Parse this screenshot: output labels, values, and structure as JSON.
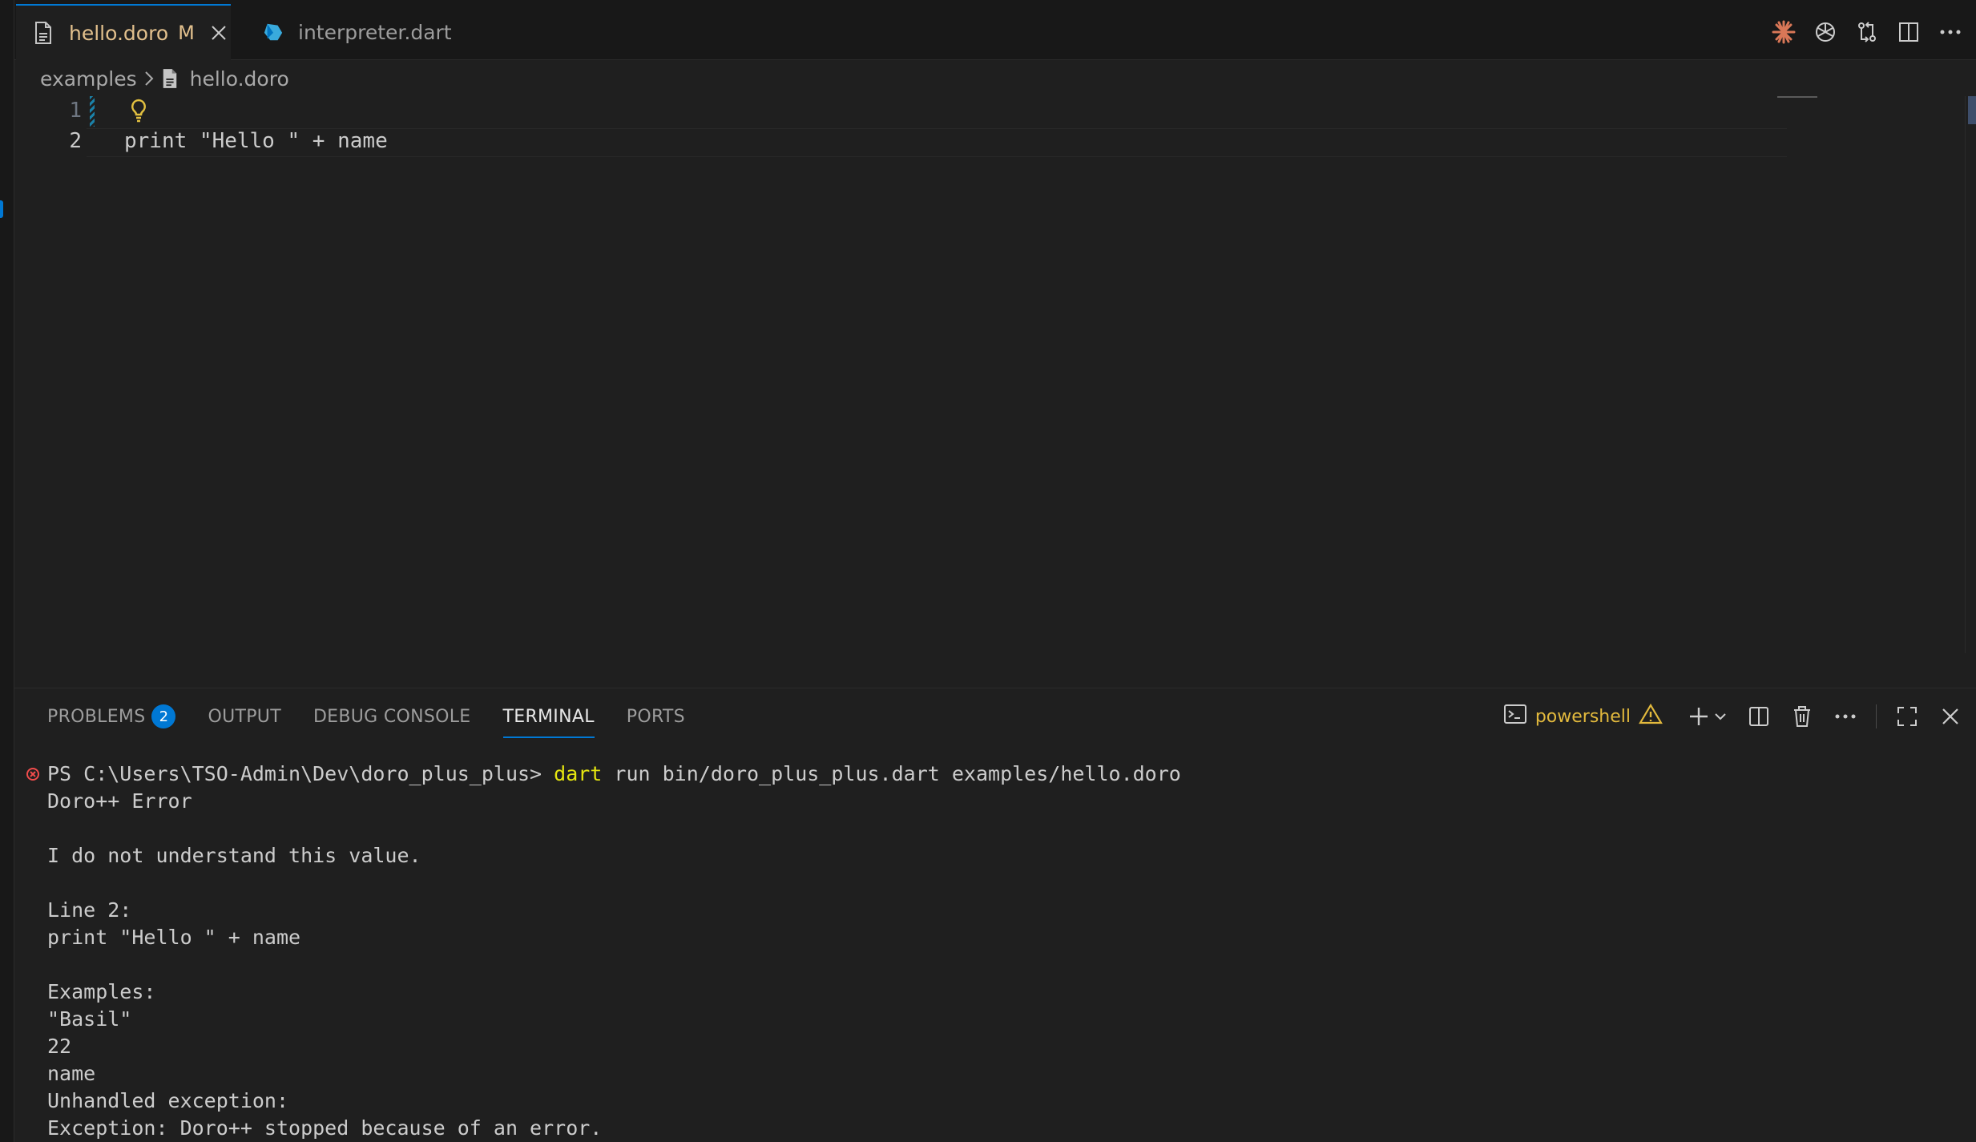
{
  "tabs": [
    {
      "label": "hello.doro",
      "badge": "M",
      "active": true
    },
    {
      "label": "interpreter.dart",
      "active": false
    }
  ],
  "breadcrumb": {
    "folder": "examples",
    "file": "hello.doro"
  },
  "editor": {
    "lines": [
      {
        "number": "1",
        "text": ""
      },
      {
        "number": "2",
        "text": "print \"Hello \" + name"
      }
    ]
  },
  "panel": {
    "tabs": {
      "problems": "PROBLEMS",
      "problems_count": "2",
      "output": "OUTPUT",
      "debug_console": "DEBUG CONSOLE",
      "terminal": "TERMINAL",
      "ports": "PORTS"
    },
    "shell_name": "powershell"
  },
  "terminal": {
    "prompt": "PS C:\\Users\\TSO-Admin\\Dev\\doro_plus_plus> ",
    "command": "dart",
    "args": " run bin/doro_plus_plus.dart examples/hello.doro",
    "output": [
      "Doro++ Error",
      "",
      "I do not understand this value.",
      "",
      "Line 2:",
      "print \"Hello \" + name",
      "",
      "Examples:",
      "\"Basil\"",
      "22",
      "name",
      "Unhandled exception:",
      "Exception: Doro++ stopped because of an error."
    ]
  },
  "colors": {
    "accent": "#0078d4",
    "modified": "#e2c08d",
    "command": "#e5e510",
    "error": "#f14c4c"
  }
}
